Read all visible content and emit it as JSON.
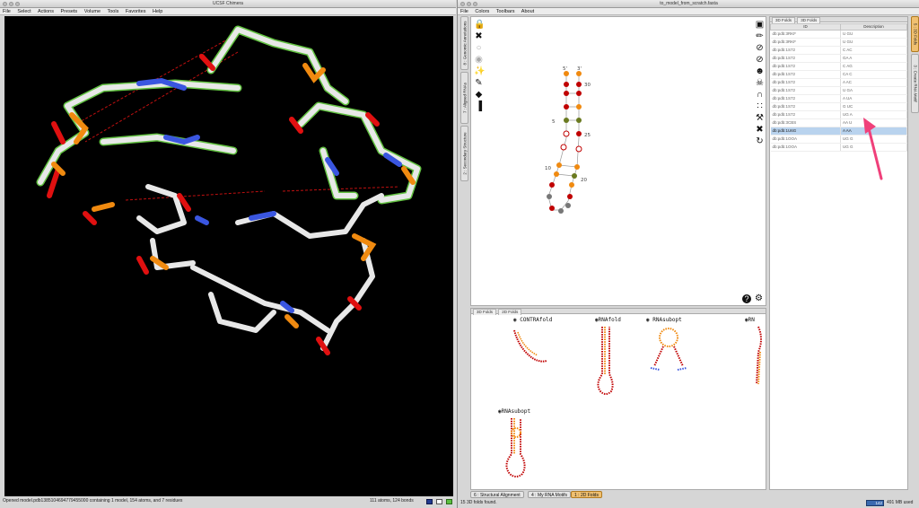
{
  "chimera": {
    "window_title": "UCSF Chimera",
    "menu": [
      "File",
      "Select",
      "Actions",
      "Presets",
      "Volume",
      "Tools",
      "Favorites",
      "Help"
    ],
    "status_left": "Opened model.pdb1385104694779455000 containing 1 model, 154 atoms, and 7 residues",
    "status_right": "111 atoms, 124 bonds",
    "colors": {
      "background": "#000000",
      "carbon": "#e8e8e8",
      "nitrogen": "#3a56e0",
      "oxygen": "#e01010",
      "phosphorus": "#f08a10",
      "highlight": "#6ed84a"
    }
  },
  "assemble": {
    "window_title": "to_model_from_scratch.fasta",
    "menu": [
      "File",
      "Colors",
      "Toolbars",
      "About"
    ],
    "left_tabs": [
      "8 : Genomic Annotations",
      "7 : Aligned RNAs",
      "2 : Secondary Structure"
    ],
    "left_tools": [
      "lock-icon",
      "compress-icon",
      "circle-icon",
      "eye-icon",
      "magic-wand-icon",
      "brush-icon",
      "tag-icon",
      "chart-icon"
    ],
    "right_tools": [
      "monitor-icon",
      "pencil-icon",
      "forbidden-icon",
      "forbidden-icon",
      "smiley-icon",
      "skull-icon",
      "magnet-icon",
      "sliders-icon",
      "brush-icon",
      "compress-icon",
      "refresh-icon"
    ],
    "structure_labels": [
      "5'",
      "3'",
      "30",
      "5",
      "25",
      "10",
      "20"
    ],
    "bottom_tools": [
      "help-icon",
      "gear-icon"
    ],
    "folds_panel": {
      "header_tabs": [
        "3D Folds",
        "2D Folds"
      ],
      "thumbnails": [
        "CONTRAfold",
        "RNAfold",
        "RNAsubopt",
        "RN",
        "RNAsubopt"
      ]
    },
    "bottom_tabs": [
      "6 : Structural Alignment",
      "4 : My RNA Motifs",
      "1 : 2D Folds"
    ],
    "status_left": "15 3D folds found.",
    "memory": "491 MB used",
    "memory_badge": "142"
  },
  "folds3d": {
    "header_tabs": [
      "3D Folds",
      "3D Folds"
    ],
    "columns": [
      "ID",
      "Description"
    ],
    "rows": [
      {
        "id": "db:pdb:3RKF",
        "desc": "U GU"
      },
      {
        "id": "db:pdb:3RKF",
        "desc": "U GU"
      },
      {
        "id": "db:pdb:1S72",
        "desc": "C AC"
      },
      {
        "id": "db:pdb:1S72",
        "desc": "GA A"
      },
      {
        "id": "db:pdb:1S72",
        "desc": "C AG"
      },
      {
        "id": "db:pdb:1S72",
        "desc": "CA C"
      },
      {
        "id": "db:pdb:1S72",
        "desc": "A AC"
      },
      {
        "id": "db:pdb:1S72",
        "desc": "U GA"
      },
      {
        "id": "db:pdb:1S72",
        "desc": "A UA"
      },
      {
        "id": "db:pdb:1S72",
        "desc": "G UC"
      },
      {
        "id": "db:pdb:1S72",
        "desc": "UG A"
      },
      {
        "id": "db:pdb:3CBS",
        "desc": "AA U"
      },
      {
        "id": "db:pdb:1U6G",
        "desc": "A AA"
      },
      {
        "id": "db:pdb:1OOA",
        "desc": "UG G"
      },
      {
        "id": "db:pdb:1OOA",
        "desc": "UG G"
      }
    ],
    "selected_index": 12,
    "right_tabs": [
      "5 : 3D Folds",
      "3 : Create RNA Motif"
    ],
    "arrow_color": "#f0407a"
  }
}
